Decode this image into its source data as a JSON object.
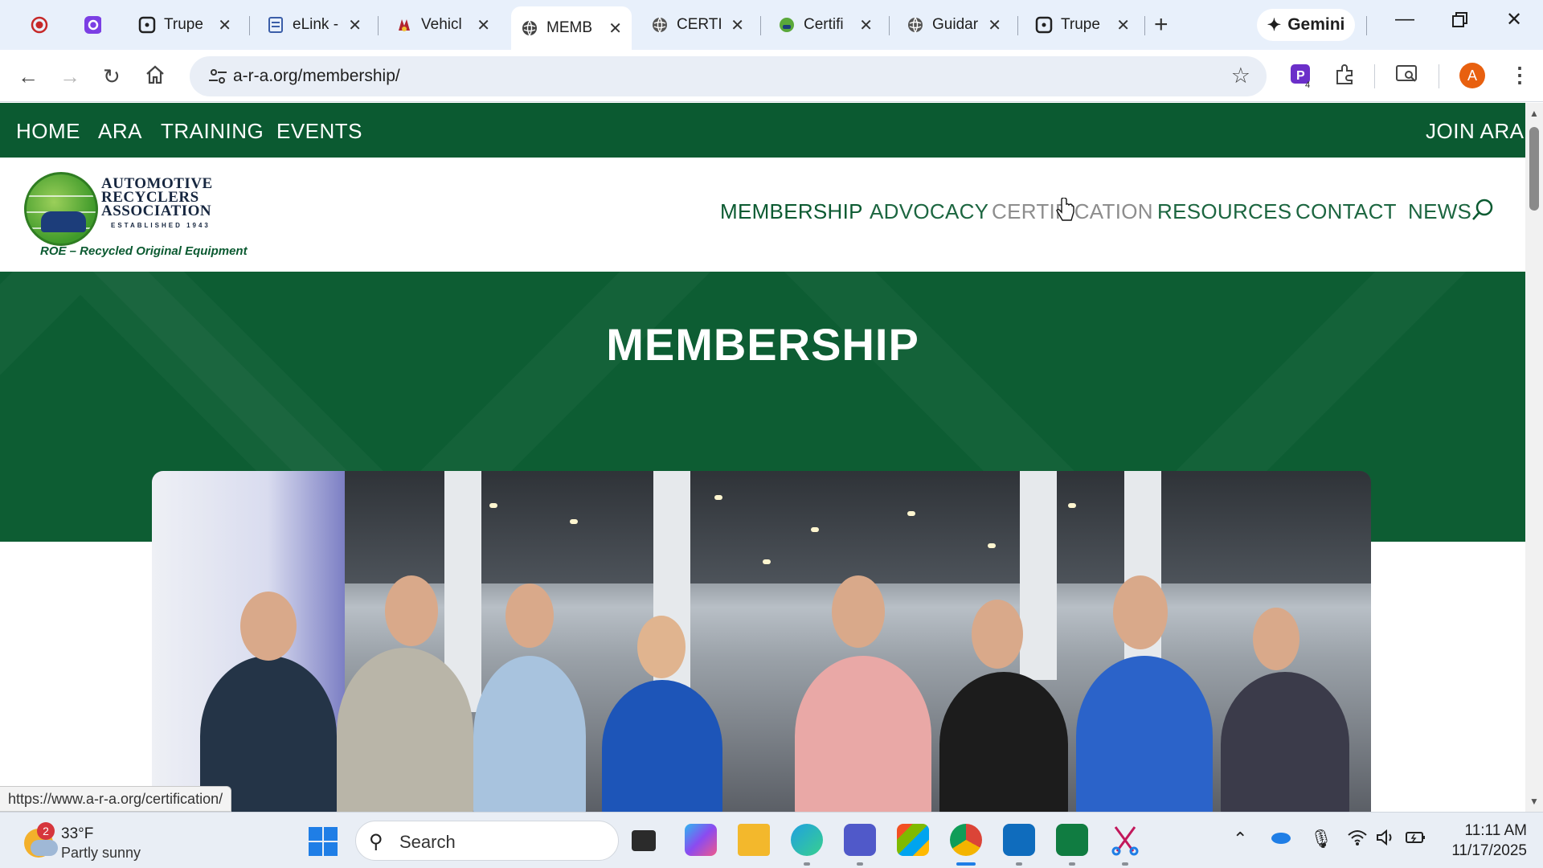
{
  "browser": {
    "tabs": [
      {
        "title": "",
        "icon": "record-icon"
      },
      {
        "title": "",
        "icon": "app-icon"
      },
      {
        "title": "Trupe",
        "icon": "tab-app-icon"
      },
      {
        "title": "eLink -",
        "icon": "doc-icon"
      },
      {
        "title": "Vehicl",
        "icon": "vehicle-icon"
      },
      {
        "title": "MEMB",
        "icon": "globe-icon",
        "active": true
      },
      {
        "title": "CERTIF",
        "icon": "globe-icon"
      },
      {
        "title": "Certifi",
        "icon": "ara-logo-icon"
      },
      {
        "title": "Guidar",
        "icon": "globe-icon"
      },
      {
        "title": "Trupe",
        "icon": "tab-app-icon"
      }
    ],
    "gemini_label": "Gemini",
    "url": "a-r-a.org/membership/",
    "extension_badge": "4",
    "profile_initial": "A"
  },
  "site": {
    "topnav": {
      "home": "HOME",
      "ara": "ARA",
      "training": "TRAINING",
      "events": "EVENTS",
      "join": "JOIN ARA"
    },
    "logo": {
      "line1": "AUTOMOTIVE",
      "line2": "RECYCLERS",
      "line3": "ASSOCIATION",
      "established": "ESTABLISHED 1943",
      "tagline": "ROE – Recycled Original Equipment"
    },
    "mainnav": {
      "membership": "MEMBERSHIP",
      "advocacy": "ADVOCACY",
      "certification": "CERTIFICATION",
      "resources": "RESOURCES",
      "contact": "CONTACT",
      "news": "NEWS"
    },
    "hero_title": "MEMBERSHIP",
    "status_url": "https://www.a-r-a.org/certification/"
  },
  "colors": {
    "brand_green": "#0b5a31",
    "chat_green": "#12a34a"
  },
  "taskbar": {
    "weather_badge": "2",
    "temperature": "33°F",
    "condition": "Partly sunny",
    "search_label": "Search",
    "time": "11:11 AM",
    "date": "11/17/2025"
  }
}
